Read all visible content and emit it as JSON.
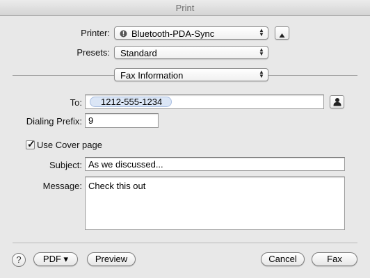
{
  "window": {
    "title": "Print"
  },
  "printer": {
    "label": "Printer:",
    "value": "Bluetooth-PDA-Sync",
    "status_icon": "alert-circle-icon"
  },
  "presets": {
    "label": "Presets:",
    "value": "Standard"
  },
  "section": {
    "value": "Fax Information"
  },
  "fax": {
    "to_label": "To:",
    "to_recipient": "1212-555-1234",
    "dialing_prefix_label": "Dialing Prefix:",
    "dialing_prefix_value": "9",
    "cover_page_label": "Use Cover page",
    "cover_page_checked": true,
    "subject_label": "Subject:",
    "subject_value": "As we discussed...",
    "message_label": "Message:",
    "message_value": "Check this out"
  },
  "footer": {
    "help_label": "?",
    "pdf_label": "PDF ▾",
    "preview_label": "Preview",
    "cancel_label": "Cancel",
    "fax_label": "Fax"
  },
  "icons": {
    "expand": "triangle-up-icon",
    "address_book": "person-icon",
    "popup_arrows": "updown-arrows-icon"
  }
}
